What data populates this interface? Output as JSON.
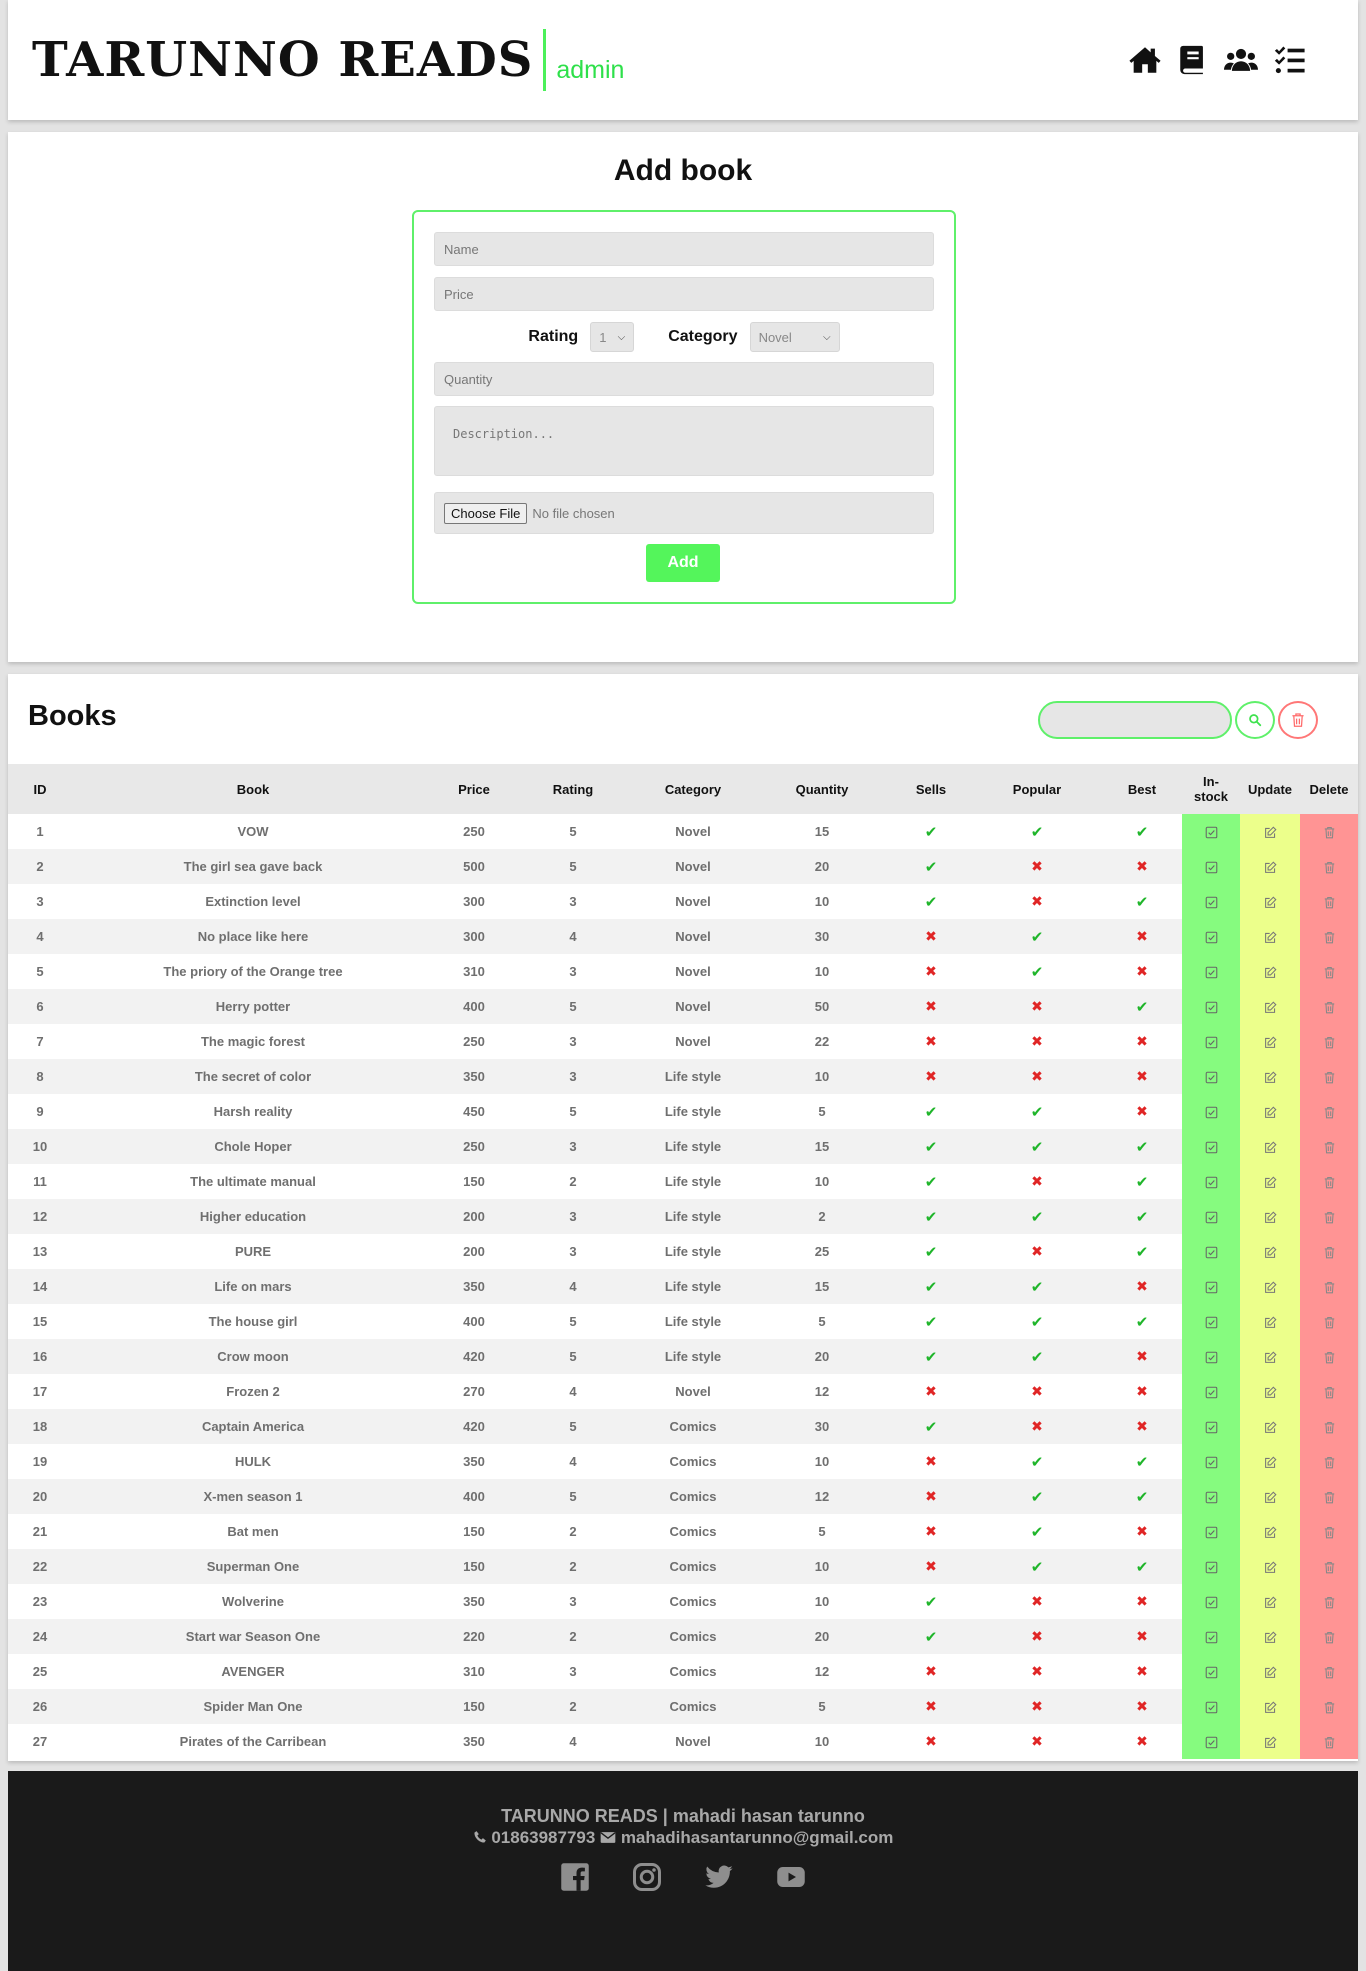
{
  "header": {
    "brand": "TARUNNO READS",
    "role": "admin",
    "nav": [
      {
        "icon": "home-icon"
      },
      {
        "icon": "book-icon"
      },
      {
        "icon": "users-icon"
      },
      {
        "icon": "task-list-icon"
      }
    ]
  },
  "add_book": {
    "title": "Add book",
    "name_placeholder": "Name",
    "price_placeholder": "Price",
    "rating_label": "Rating",
    "rating_value": "1",
    "category_label": "Category",
    "category_value": "Novel",
    "quantity_placeholder": "Quantity",
    "description_placeholder": "Description...",
    "file_button": "Choose File",
    "file_status": "No file chosen",
    "add_label": "Add"
  },
  "books": {
    "title": "Books",
    "columns": [
      "ID",
      "Book",
      "Price",
      "Rating",
      "Category",
      "Quantity",
      "Sells",
      "Popular",
      "Best",
      "In-stock",
      "Update",
      "Delete"
    ],
    "rows": [
      {
        "id": "1",
        "book": "VOW",
        "price": "250",
        "rating": "5",
        "category": "Novel",
        "quantity": "15",
        "sells": true,
        "popular": true,
        "best": true
      },
      {
        "id": "2",
        "book": "The girl sea gave back",
        "price": "500",
        "rating": "5",
        "category": "Novel",
        "quantity": "20",
        "sells": true,
        "popular": false,
        "best": false
      },
      {
        "id": "3",
        "book": "Extinction level",
        "price": "300",
        "rating": "3",
        "category": "Novel",
        "quantity": "10",
        "sells": true,
        "popular": false,
        "best": true
      },
      {
        "id": "4",
        "book": "No place like here",
        "price": "300",
        "rating": "4",
        "category": "Novel",
        "quantity": "30",
        "sells": false,
        "popular": true,
        "best": false
      },
      {
        "id": "5",
        "book": "The priory of the Orange tree",
        "price": "310",
        "rating": "3",
        "category": "Novel",
        "quantity": "10",
        "sells": false,
        "popular": true,
        "best": false
      },
      {
        "id": "6",
        "book": "Herry potter",
        "price": "400",
        "rating": "5",
        "category": "Novel",
        "quantity": "50",
        "sells": false,
        "popular": false,
        "best": true
      },
      {
        "id": "7",
        "book": "The magic forest",
        "price": "250",
        "rating": "3",
        "category": "Novel",
        "quantity": "22",
        "sells": false,
        "popular": false,
        "best": false
      },
      {
        "id": "8",
        "book": "The secret of color",
        "price": "350",
        "rating": "3",
        "category": "Life style",
        "quantity": "10",
        "sells": false,
        "popular": false,
        "best": false
      },
      {
        "id": "9",
        "book": "Harsh reality",
        "price": "450",
        "rating": "5",
        "category": "Life style",
        "quantity": "5",
        "sells": true,
        "popular": true,
        "best": false
      },
      {
        "id": "10",
        "book": "Chole Hoper",
        "price": "250",
        "rating": "3",
        "category": "Life style",
        "quantity": "15",
        "sells": true,
        "popular": true,
        "best": true
      },
      {
        "id": "11",
        "book": "The ultimate manual",
        "price": "150",
        "rating": "2",
        "category": "Life style",
        "quantity": "10",
        "sells": true,
        "popular": false,
        "best": true
      },
      {
        "id": "12",
        "book": "Higher education",
        "price": "200",
        "rating": "3",
        "category": "Life style",
        "quantity": "2",
        "sells": true,
        "popular": true,
        "best": true
      },
      {
        "id": "13",
        "book": "PURE",
        "price": "200",
        "rating": "3",
        "category": "Life style",
        "quantity": "25",
        "sells": true,
        "popular": false,
        "best": true
      },
      {
        "id": "14",
        "book": "Life on mars",
        "price": "350",
        "rating": "4",
        "category": "Life style",
        "quantity": "15",
        "sells": true,
        "popular": true,
        "best": false
      },
      {
        "id": "15",
        "book": "The house girl",
        "price": "400",
        "rating": "5",
        "category": "Life style",
        "quantity": "5",
        "sells": true,
        "popular": true,
        "best": true
      },
      {
        "id": "16",
        "book": "Crow moon",
        "price": "420",
        "rating": "5",
        "category": "Life style",
        "quantity": "20",
        "sells": true,
        "popular": true,
        "best": false
      },
      {
        "id": "17",
        "book": "Frozen 2",
        "price": "270",
        "rating": "4",
        "category": "Novel",
        "quantity": "12",
        "sells": false,
        "popular": false,
        "best": false
      },
      {
        "id": "18",
        "book": "Captain America",
        "price": "420",
        "rating": "5",
        "category": "Comics",
        "quantity": "30",
        "sells": true,
        "popular": false,
        "best": false
      },
      {
        "id": "19",
        "book": "HULK",
        "price": "350",
        "rating": "4",
        "category": "Comics",
        "quantity": "10",
        "sells": false,
        "popular": true,
        "best": true
      },
      {
        "id": "20",
        "book": "X-men season 1",
        "price": "400",
        "rating": "5",
        "category": "Comics",
        "quantity": "12",
        "sells": false,
        "popular": true,
        "best": true
      },
      {
        "id": "21",
        "book": "Bat men",
        "price": "150",
        "rating": "2",
        "category": "Comics",
        "quantity": "5",
        "sells": false,
        "popular": true,
        "best": false
      },
      {
        "id": "22",
        "book": "Superman One",
        "price": "150",
        "rating": "2",
        "category": "Comics",
        "quantity": "10",
        "sells": false,
        "popular": true,
        "best": true
      },
      {
        "id": "23",
        "book": "Wolverine",
        "price": "350",
        "rating": "3",
        "category": "Comics",
        "quantity": "10",
        "sells": true,
        "popular": false,
        "best": false
      },
      {
        "id": "24",
        "book": "Start war Season One",
        "price": "220",
        "rating": "2",
        "category": "Comics",
        "quantity": "20",
        "sells": true,
        "popular": false,
        "best": false
      },
      {
        "id": "25",
        "book": "AVENGER",
        "price": "310",
        "rating": "3",
        "category": "Comics",
        "quantity": "12",
        "sells": false,
        "popular": false,
        "best": false
      },
      {
        "id": "26",
        "book": "Spider Man One",
        "price": "150",
        "rating": "2",
        "category": "Comics",
        "quantity": "5",
        "sells": false,
        "popular": false,
        "best": false
      },
      {
        "id": "27",
        "book": "Pirates of the Carribean",
        "price": "350",
        "rating": "4",
        "category": "Novel",
        "quantity": "10",
        "sells": false,
        "popular": false,
        "best": false
      }
    ]
  },
  "footer": {
    "line1": "TARUNNO READS | mahadi hasan tarunno",
    "phone": "01863987793",
    "email": "mahadihasantarunno@gmail.com",
    "social": [
      "facebook-icon",
      "instagram-icon",
      "twitter-icon",
      "youtube-icon"
    ]
  },
  "colors": {
    "accent": "#4cf05a",
    "instock": "#86fb7f",
    "update": "#ecff8b",
    "delete": "#ff9494",
    "yes": "#1fb52a",
    "no": "#e02525",
    "footer_bg": "#1a1a1a"
  }
}
